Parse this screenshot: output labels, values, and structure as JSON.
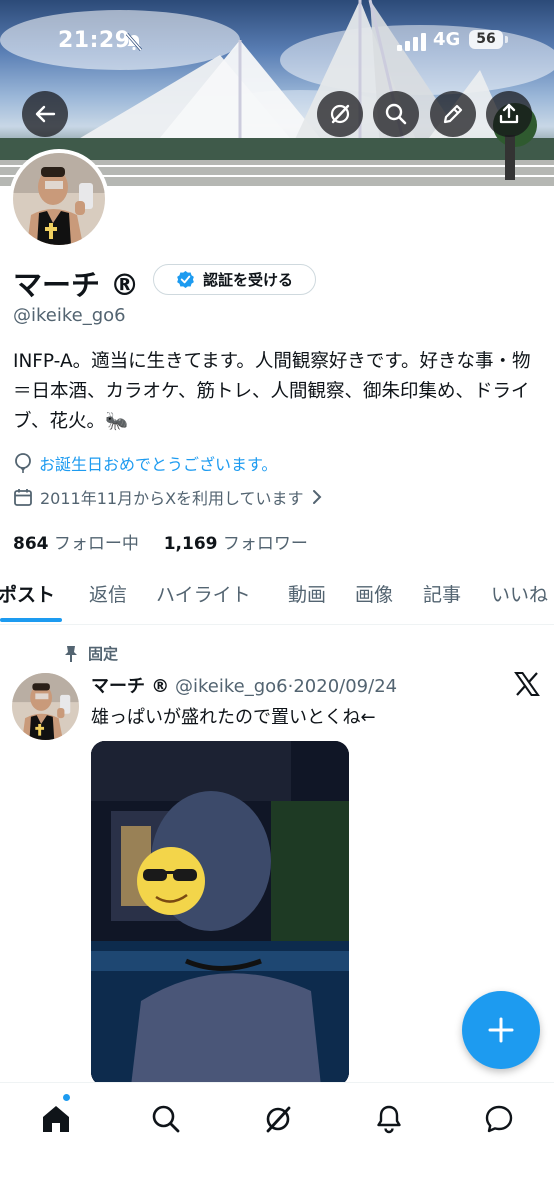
{
  "status_bar": {
    "time": "21:29",
    "network": "4G",
    "battery": "56"
  },
  "profile": {
    "name": "マーチ ®",
    "verify_button": "認証を受ける",
    "handle": "@ikeike_go6",
    "bio": "INFP-A。適当に生きてます。人間観察好きです。好きな事・物＝日本酒、カラオケ、筋トレ、人間観察、御朱印集め、ドライブ、花火。🐜",
    "birthday_text": "お誕生日おめでとうございます。",
    "joined_text": "2011年11月からXを利用しています",
    "following_count": "864",
    "following_label": "フォロー中",
    "followers_count": "1,169",
    "followers_label": "フォロワー"
  },
  "tabs": [
    "ポスト",
    "返信",
    "ハイライト",
    "動画",
    "画像",
    "記事",
    "いいね"
  ],
  "post": {
    "pinned_label": "固定",
    "author_name": "マーチ ®",
    "author_handle": "@ikeike_go6",
    "date": "·2020/09/24",
    "text": "雄っぱいが盛れたので置いとくね←"
  },
  "colors": {
    "accent": "#1d9bf0",
    "text": "#0f1419",
    "secondary": "#536471"
  }
}
